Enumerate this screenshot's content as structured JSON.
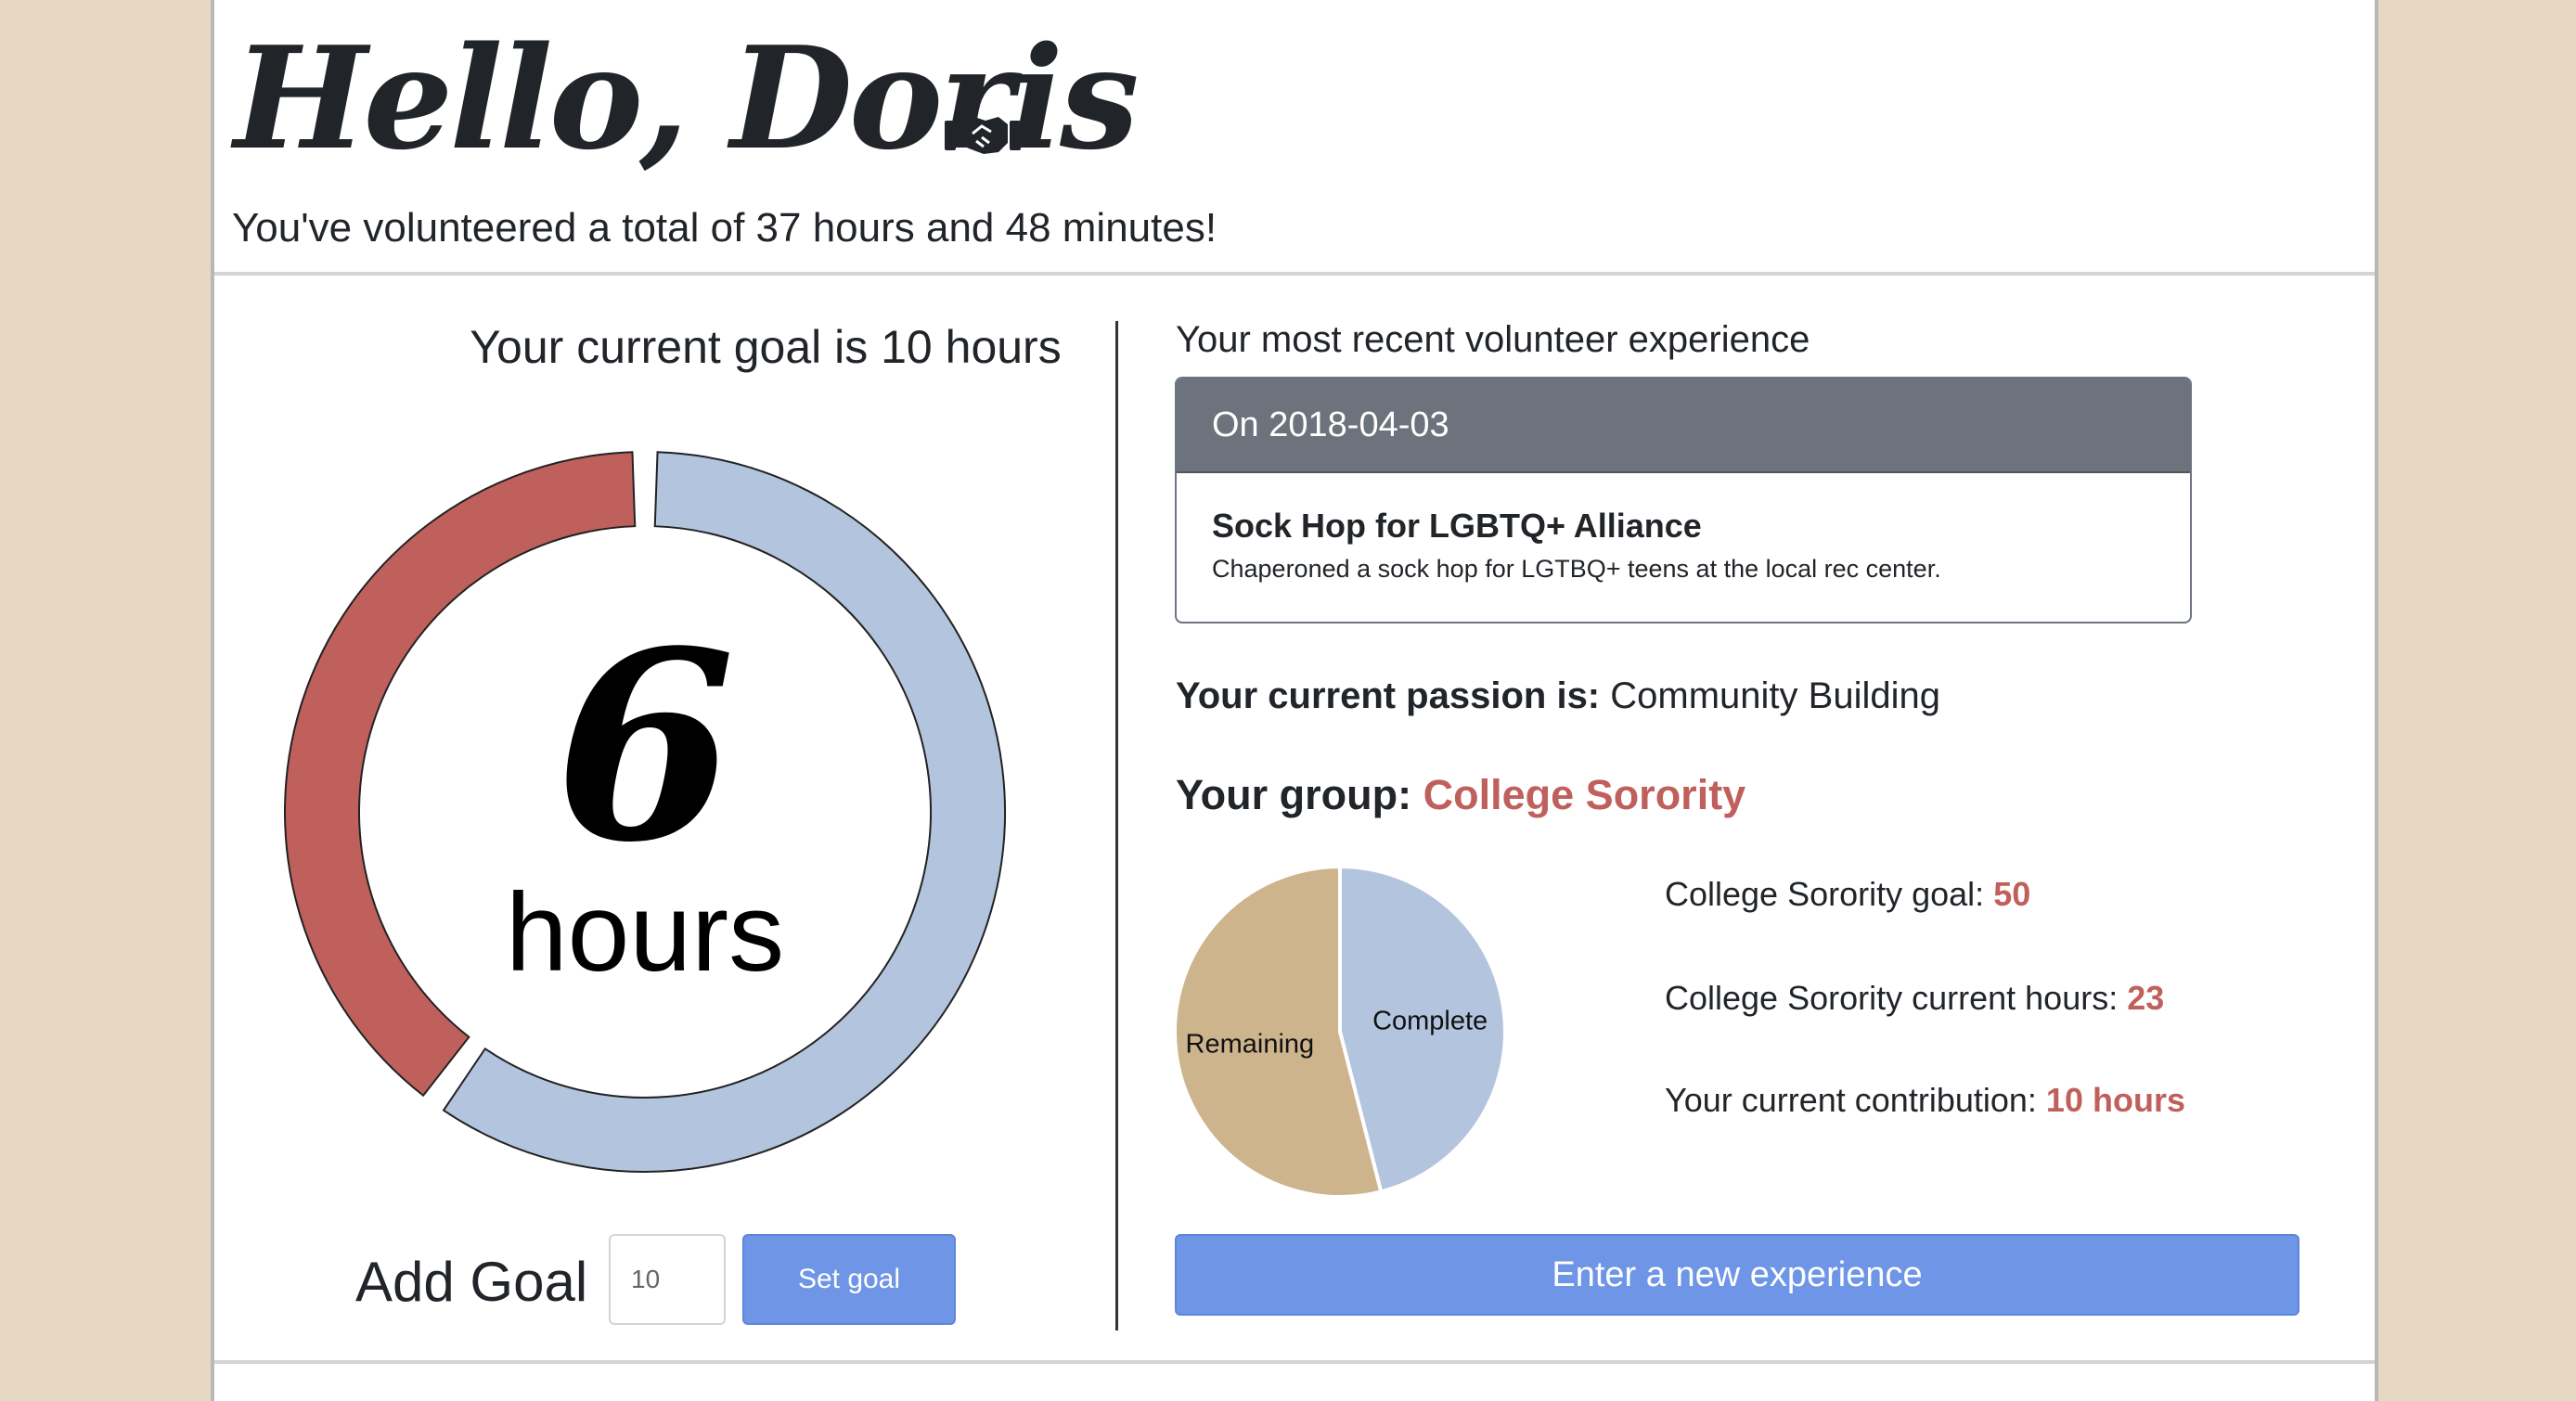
{
  "colors": {
    "page_background": "#e6d8c3",
    "accent": "#c0605c",
    "progress_complete": "#b3c4de",
    "progress_remaining": "#c0605c",
    "pie_remaining": "#cdb48d",
    "pie_complete": "#b3c4de",
    "button": "#6e95e6",
    "card_header": "#6c737c"
  },
  "header": {
    "greeting": "Hello, Doris",
    "icon": "handshake-icon",
    "total_text": "You've volunteered a total of 37 hours and 48 minutes!"
  },
  "goal": {
    "title": "Your current goal is 10 hours",
    "hours_value": "6",
    "hours_unit": "hours",
    "progress_fraction": 0.6,
    "add_label": "Add Goal",
    "input_value": "10",
    "button_label": "Set goal"
  },
  "recent": {
    "title": "Your most recent volunteer experience",
    "date_label": "On 2018-04-03",
    "experience_title": "Sock Hop for LGBTQ+ Alliance",
    "experience_description": "Chaperoned a sock hop for LGTBQ+ teens at the local rec center."
  },
  "passion": {
    "label": "Your current passion is:",
    "value": "Community Building"
  },
  "group": {
    "label": "Your group:",
    "name": "College Sorority",
    "stats": [
      {
        "label": "College Sorority goal:",
        "value": "50"
      },
      {
        "label": "College Sorority current hours:",
        "value": "23"
      },
      {
        "label": "Your current contribution:",
        "value": "10 hours"
      }
    ]
  },
  "chart_data": {
    "type": "pie",
    "categories": [
      "Complete",
      "Remaining"
    ],
    "values": [
      23,
      27
    ]
  },
  "actions": {
    "new_experience_label": "Enter a new experience"
  }
}
